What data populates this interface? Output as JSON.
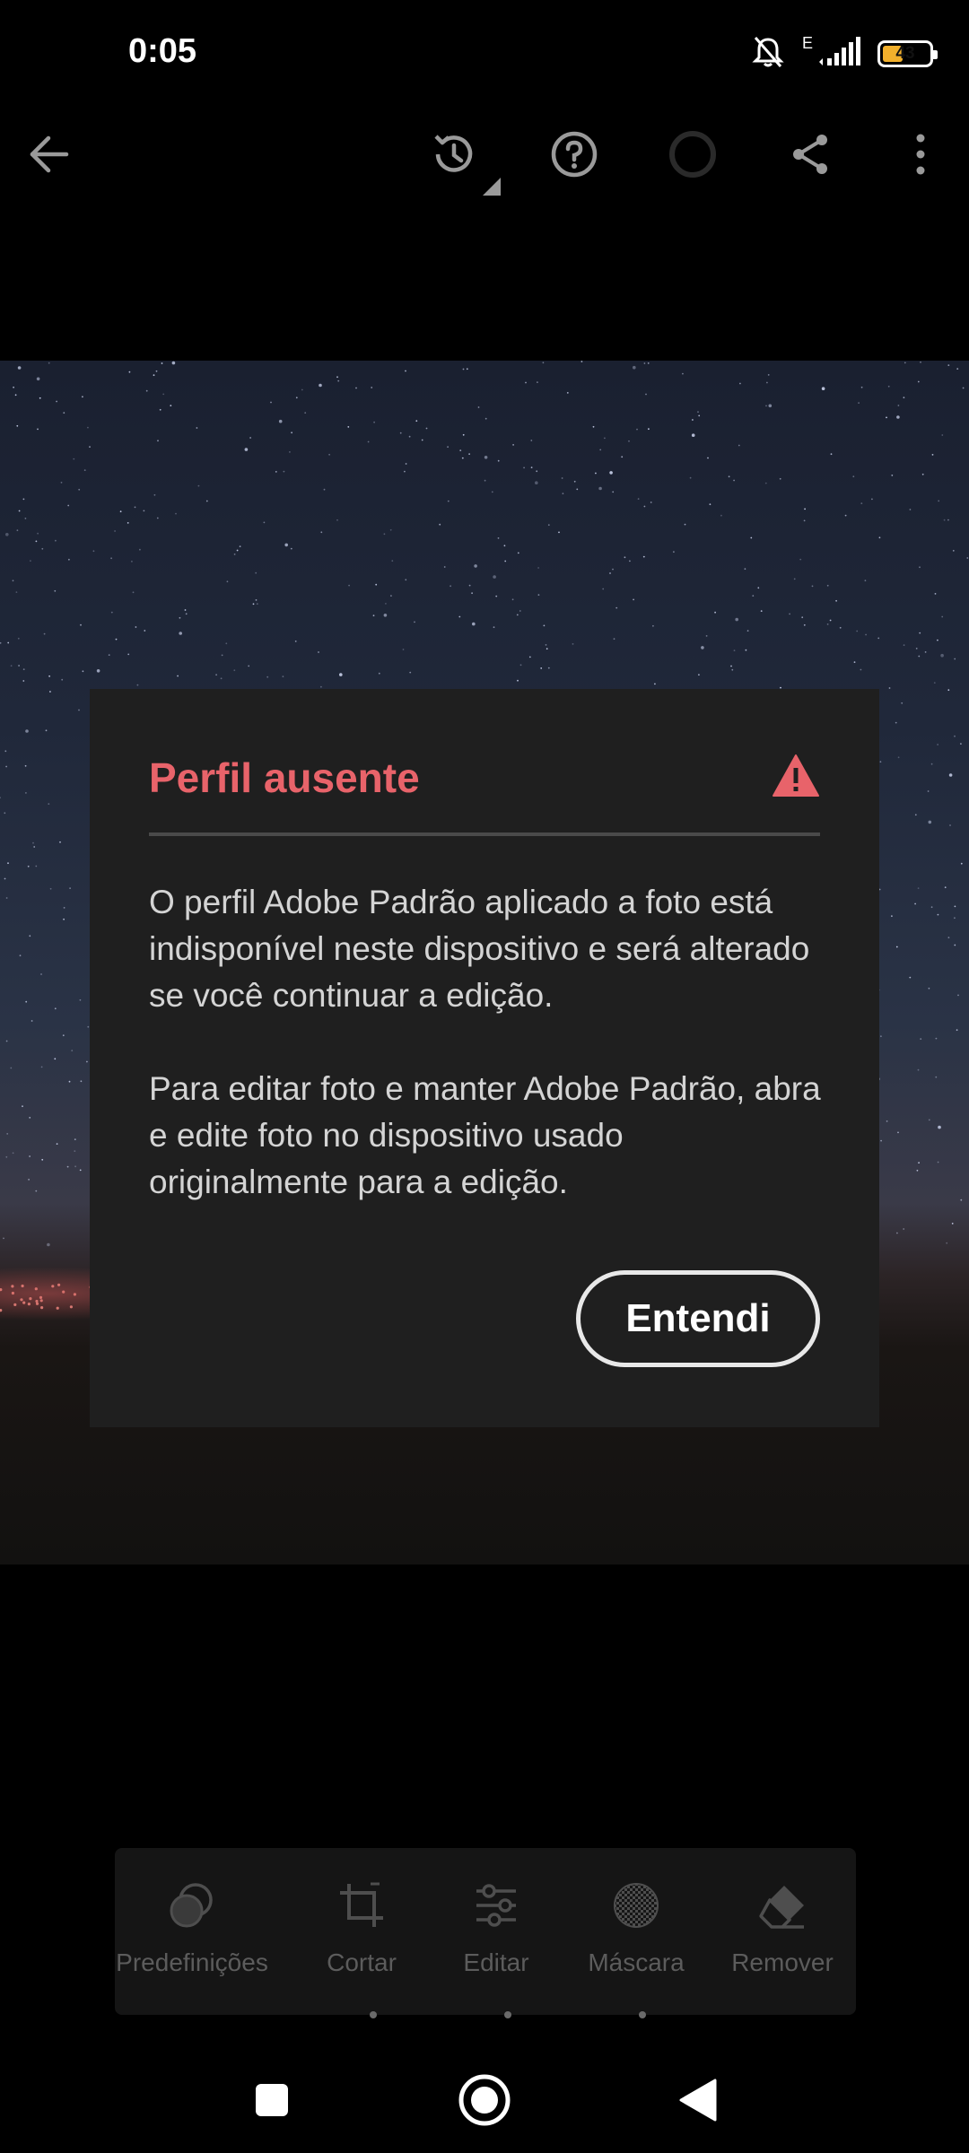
{
  "status_bar": {
    "time": "0:05",
    "network_type": "E",
    "battery_level": "43",
    "battery_percent": 43,
    "icons": [
      "bell-off-icon",
      "signal-icon",
      "battery-icon"
    ]
  },
  "toolbar": {
    "icons": [
      "back-arrow-icon",
      "history-icon",
      "help-icon",
      "cloud-sync-icon",
      "share-icon",
      "more-vertical-icon"
    ]
  },
  "dialog": {
    "title": "Perfil ausente",
    "icon": "warning-icon",
    "paragraph_1": "O perfil Adobe Padrão aplicado a foto está indisponível neste dispositivo e será alterado se você continuar a edição.",
    "paragraph_2": "Para editar foto e manter Adobe Padrão, abra e edite foto no dispositivo usado originalmente para a edição.",
    "button_label": "Entendi",
    "colors": {
      "title": "#e8636a",
      "background": "#1f1f1f"
    }
  },
  "tools": {
    "presets": "Predefinições",
    "crop": "Cortar",
    "edit": "Editar",
    "mask": "Máscara",
    "remove": "Remover"
  },
  "nav_bar": {
    "icons": [
      "recents-square-icon",
      "home-circle-icon",
      "back-triangle-icon"
    ]
  }
}
